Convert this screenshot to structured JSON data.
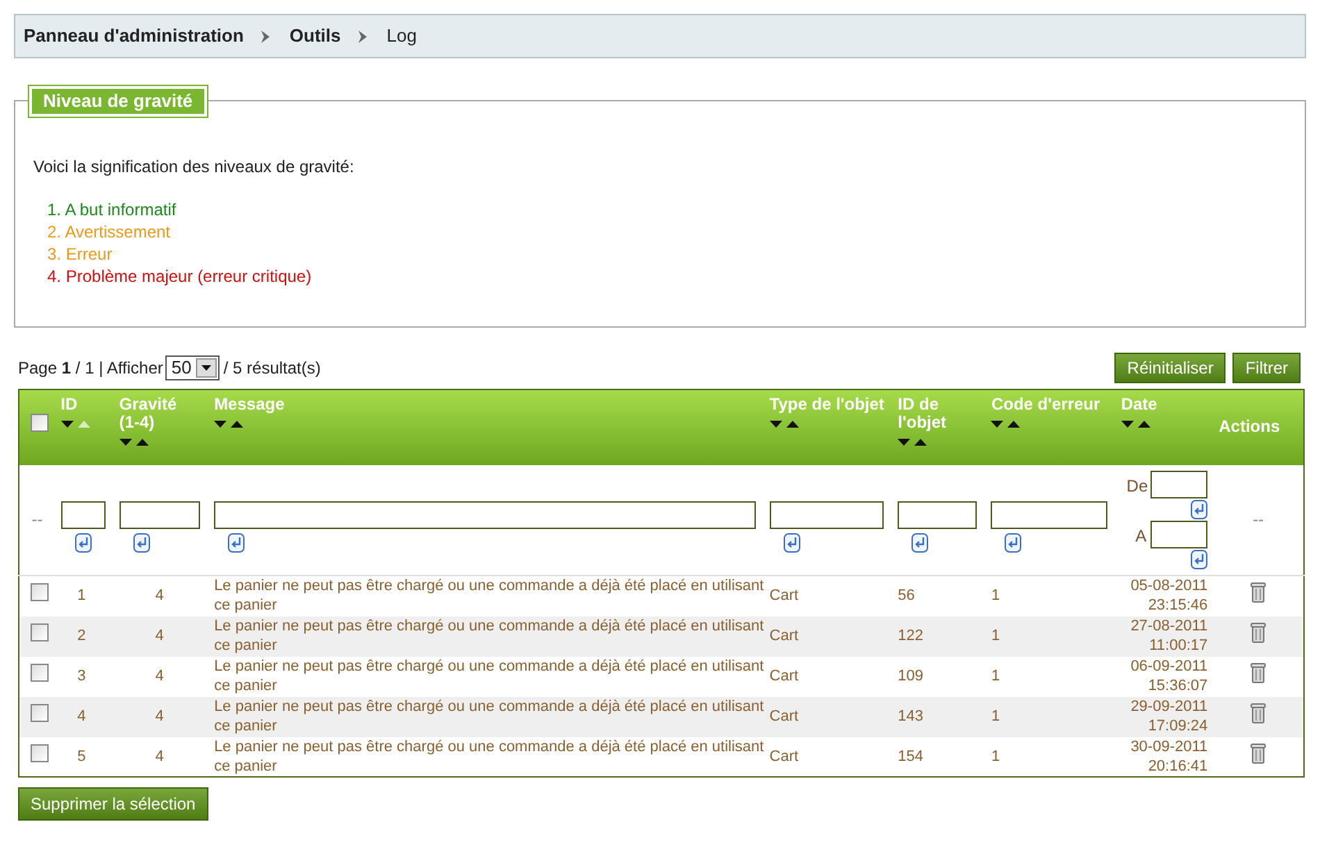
{
  "breadcrumb": [
    {
      "label": "Panneau d'administration"
    },
    {
      "label": "Outils"
    },
    {
      "label": "Log"
    }
  ],
  "severity_panel": {
    "legend": "Niveau de gravité",
    "intro": "Voici la signification des niveaux de gravité:",
    "levels": [
      {
        "number": "1.",
        "label": "A but informatif",
        "color": "#1e8a1e"
      },
      {
        "number": "2.",
        "label": "Avertissement",
        "color": "#e89a1c"
      },
      {
        "number": "3.",
        "label": "Erreur",
        "color": "#e89a1c"
      },
      {
        "number": "4.",
        "label": "Problème majeur (erreur critique)",
        "color": "#d01010"
      }
    ]
  },
  "pagination": {
    "page_label": "Page",
    "page": "1",
    "separator": "/",
    "total_pages": "1",
    "show_label": "| Afficher",
    "per_page": "50",
    "results": "/ 5 résultat(s)"
  },
  "buttons": [
    {
      "label": "Réinitialiser"
    },
    {
      "label": "Filtrer"
    }
  ],
  "table": {
    "select_all": {
      "checked": false
    },
    "columns": [
      {
        "label": "ID",
        "kind": "text",
        "sort_active": true
      },
      {
        "label": "Gravité (1-4)",
        "kind": "text",
        "sort_active": false
      },
      {
        "label": "Message",
        "kind": "text",
        "sort_active": false
      },
      {
        "label": "Type de l'objet",
        "kind": "text",
        "sort_active": false
      },
      {
        "label": "ID de l'objet",
        "kind": "text",
        "sort_active": false
      },
      {
        "label": "Code d'erreur",
        "kind": "text",
        "sort_active": false
      },
      {
        "label": "Date",
        "kind": "date",
        "sort_active": false
      },
      {
        "label": "Actions",
        "kind": "actions"
      }
    ],
    "filter_row": {
      "select_placeholder": "--",
      "actions_placeholder": "--",
      "date_from_label": "De",
      "date_to_label": "A"
    },
    "rows": [
      {
        "checked": false,
        "cells": [
          "1",
          "4",
          "Le panier ne peut pas être chargé ou une commande a déjà été placé en utilisant ce panier",
          "Cart",
          "56",
          "1",
          "05-08-2011 23:15:46"
        ]
      },
      {
        "checked": false,
        "cells": [
          "2",
          "4",
          "Le panier ne peut pas être chargé ou une commande a déjà été placé en utilisant ce panier",
          "Cart",
          "122",
          "1",
          "27-08-2011 11:00:17"
        ]
      },
      {
        "checked": false,
        "cells": [
          "3",
          "4",
          "Le panier ne peut pas être chargé ou une commande a déjà été placé en utilisant ce panier",
          "Cart",
          "109",
          "1",
          "06-09-2011 15:36:07"
        ]
      },
      {
        "checked": false,
        "cells": [
          "4",
          "4",
          "Le panier ne peut pas être chargé ou une commande a déjà été placé en utilisant ce panier",
          "Cart",
          "143",
          "1",
          "29-09-2011 17:09:24"
        ]
      },
      {
        "checked": false,
        "cells": [
          "5",
          "4",
          "Le panier ne peut pas être chargé ou une commande a déjà été placé en utilisant ce panier",
          "Cart",
          "154",
          "1",
          "30-09-2011 20:16:41"
        ]
      }
    ]
  },
  "footer_button": {
    "label": "Supprimer la sélection"
  }
}
